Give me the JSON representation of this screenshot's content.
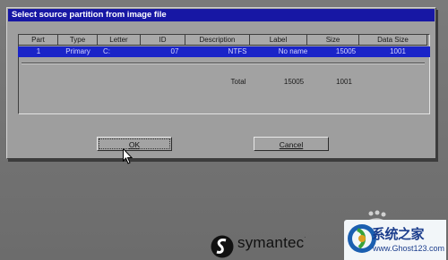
{
  "dialog": {
    "title": "Select source partition from image file",
    "columns": [
      "Part",
      "Type",
      "Letter",
      "ID",
      "Description",
      "Label",
      "Size",
      "Data Size"
    ],
    "rows": [
      {
        "part": "1",
        "type": "Primary",
        "letter": "C:",
        "id": "07",
        "description": "NTFS",
        "label": "No name",
        "size": "15005",
        "data_size": "1001"
      }
    ],
    "total": {
      "label": "Total",
      "size": "15005",
      "data_size": "1001"
    },
    "ok_label": "OK",
    "cancel_label": "Cancel"
  },
  "branding": {
    "logo_text": "symantec",
    "trademark": "."
  },
  "watermark": {
    "title": "系统之家",
    "url": "www.Ghost123.com"
  },
  "colors": {
    "title_bar": "#1717a4",
    "selection": "#1a24c8",
    "dialog_bg": "#9e9e9e",
    "desktop_bg": "#747474"
  }
}
